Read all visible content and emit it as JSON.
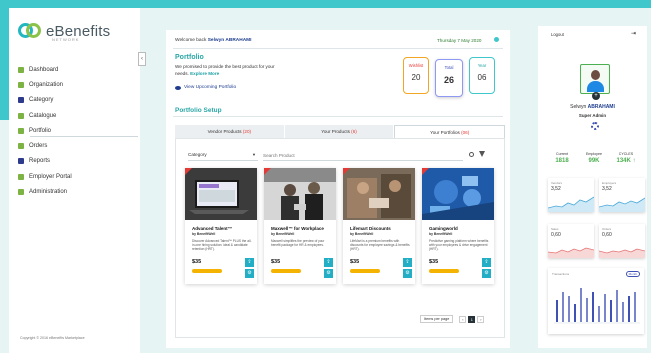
{
  "brand": {
    "name": "eBenefits",
    "tagline": "NETWORK"
  },
  "colors": {
    "accent": "#3fc7cc",
    "primary": "#1e3d8f",
    "success": "#4caf50",
    "danger": "#e53935"
  },
  "sidebar": {
    "items": [
      {
        "label": "Dashboard",
        "icon": "dashboard-icon",
        "color": "#7cb342"
      },
      {
        "label": "Organization",
        "icon": "organization-icon",
        "color": "#7cb342"
      },
      {
        "label": "Category",
        "icon": "category-icon",
        "color": "#2e3a8c"
      },
      {
        "label": "Catalogue",
        "icon": "catalogue-icon",
        "color": "#7cb342"
      },
      {
        "label": "Portfolio",
        "icon": "portfolio-icon",
        "color": "#7cb342",
        "active": true
      },
      {
        "label": "Orders",
        "icon": "orders-icon",
        "color": "#7cb342"
      },
      {
        "label": "Reports",
        "icon": "reports-icon",
        "color": "#2e3a8c"
      },
      {
        "label": "Employer Portal",
        "icon": "employer-portal-icon",
        "color": "#7cb342"
      },
      {
        "label": "Administration",
        "icon": "administration-icon",
        "color": "#7cb342"
      }
    ],
    "copyright": "Copyright © 2016 eBenefits Marketplace"
  },
  "header": {
    "welcome_prefix": "Welcome back ",
    "user": "Selwyn ABRAHAMI",
    "date": "Thursday 7 May 2020"
  },
  "portfolio": {
    "title": "Portfolio",
    "desc": "We promised to provide the best product for your needs.",
    "explore_link": "Explore More",
    "view_upcoming": "View Upcoming Portfolio",
    "stats": [
      {
        "label": "Wishlist",
        "value": "20"
      },
      {
        "label": "Total",
        "value": "26"
      },
      {
        "label": "Year",
        "value": "06"
      }
    ]
  },
  "setup": {
    "title": "Portfolio Setup",
    "tabs": [
      {
        "label": "Vendor Products",
        "count": "(20)"
      },
      {
        "label": "Your Products",
        "count": "(6)"
      },
      {
        "label": "Your Portfolios",
        "count": "(06)"
      }
    ],
    "category_label": "Category",
    "search_placeholder": "Search Product"
  },
  "products": [
    {
      "name": "Advanced Talent™",
      "by": "by BenefitWell",
      "desc": "Discover Advanced Talent™ PLUS the all-in-one hiring solution: ideal & candidate retention (HRT).",
      "price": "$35"
    },
    {
      "name": "Maxwell™ for Workplace",
      "by": "by BenefitWell",
      "desc": "Maxwell simplifies the preview of your benefit package for HR & employees.",
      "price": "$35"
    },
    {
      "name": "Lifemart Discounts",
      "by": "by BenefitWell",
      "desc": "LifeMart is a premium benefits with discounts for employee savings & benefits (HRT).",
      "price": "$35"
    },
    {
      "name": "Gamingworld",
      "by": "by BenefitWell",
      "desc": "Predictive gaming platform where benefits with your employees & drive engagement (HRT).",
      "price": "$35"
    }
  ],
  "pager": {
    "per_page_label": "Items per page",
    "current": "1"
  },
  "profile": {
    "logout": "Logout",
    "name_prefix": "Selwyn ",
    "name_bold": "ABRAHAMI",
    "role": "Super Admin"
  },
  "kpis": [
    {
      "label": "Current",
      "value": "1818"
    },
    {
      "label": "Employee",
      "value": "99K"
    },
    {
      "label": "CYCLES",
      "value": "134K ↑"
    }
  ],
  "minis": [
    {
      "label": "Vendors",
      "value": "3,52"
    },
    {
      "label": "Employers",
      "value": "3,52"
    },
    {
      "label": "Sales",
      "value": "0,60"
    },
    {
      "label": "Orders",
      "value": "0,60"
    }
  ],
  "bar_chart": {
    "label": "Transactions",
    "select": "Month"
  }
}
